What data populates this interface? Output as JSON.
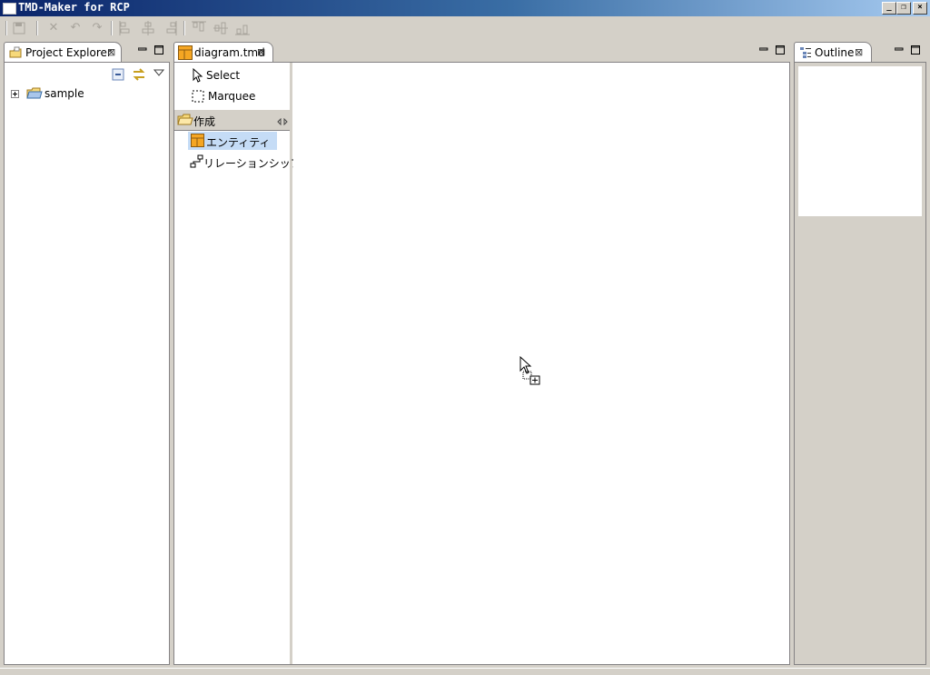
{
  "window": {
    "title": "TMD-Maker for RCP",
    "controls": {
      "minimize": "_",
      "restore": "❐",
      "close": "×"
    }
  },
  "toolbar": {
    "icons": [
      "save-icon",
      "delete-icon",
      "undo-icon",
      "redo-icon",
      "align-left-icon",
      "align-center-icon",
      "align-right-icon",
      "align-top-icon",
      "align-middle-icon",
      "align-bottom-icon"
    ]
  },
  "project_explorer": {
    "tab_label": "Project Explorer",
    "close": "⊠",
    "tree": [
      {
        "label": "sample",
        "expander": "+"
      }
    ]
  },
  "editor": {
    "tab_label": "diagram.tmd",
    "close": "⊠"
  },
  "palette": {
    "tools": [
      {
        "label": "Select"
      },
      {
        "label": "Marquee"
      }
    ],
    "drawer_label": "作成",
    "drawer_items": [
      {
        "label": "エンティティ",
        "selected": true
      },
      {
        "label": "リレーションシップ",
        "selected": false
      }
    ]
  },
  "outline": {
    "tab_label": "Outline",
    "close": "⊠"
  },
  "colors": {
    "title_start": "#0a246a",
    "title_end": "#a6caf0",
    "selection": "#c5dcf6",
    "entity_icon": "#f5a623"
  }
}
